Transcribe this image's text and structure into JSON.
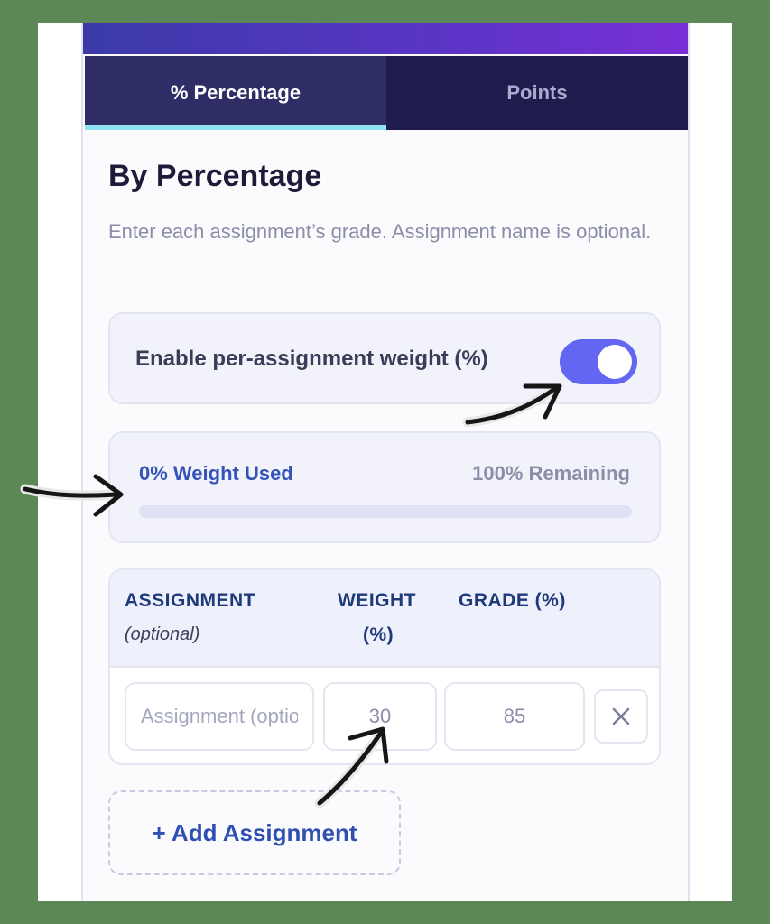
{
  "tabs": [
    {
      "icon": "%",
      "label": "Percentage",
      "active": true
    },
    {
      "label": "Points",
      "active": false
    }
  ],
  "section": {
    "title": "By Percentage",
    "description": "Enter each assignment’s grade. Assignment name is optional."
  },
  "weight_toggle": {
    "label": "Enable per-assignment weight (%)",
    "enabled": true
  },
  "weight_summary": {
    "used_label": "0% Weight Used",
    "remaining_label": "100% Remaining",
    "used_fraction": 0
  },
  "table": {
    "headers": {
      "assignment": "ASSIGNMENT",
      "assignment_sub": "(optional)",
      "weight": "WEIGHT",
      "weight_sub": "(%)",
      "grade": "GRADE (%)"
    },
    "rows": [
      {
        "name_placeholder": "Assignment (optional)",
        "name": "",
        "weight": "30",
        "grade": "85"
      }
    ]
  },
  "add_button": {
    "label": "+ Add Assignment"
  },
  "colors": {
    "accent": "#6366f1",
    "tab_bar": "#1f1b4d",
    "link_blue": "#2f4fb3",
    "frame_green": "#5c8757"
  }
}
